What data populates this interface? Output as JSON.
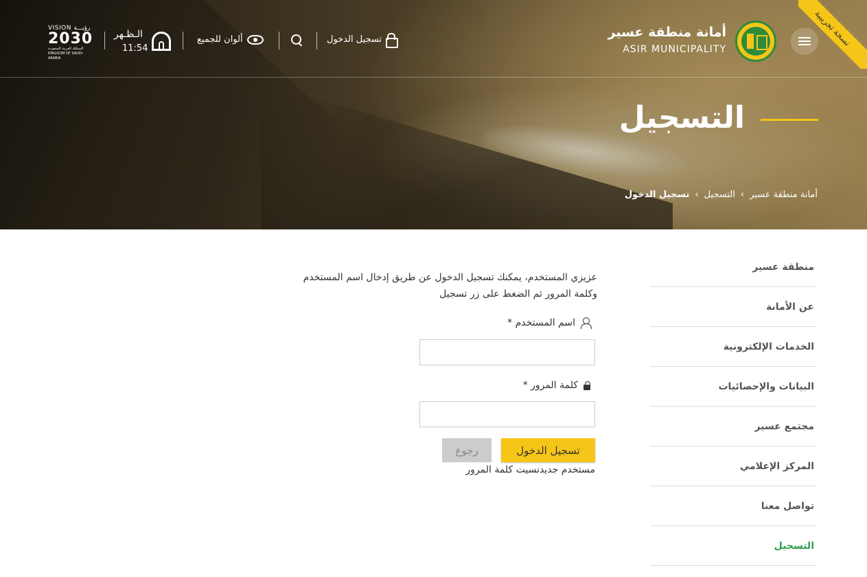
{
  "header": {
    "ribbon": "نسخة تجريبية",
    "logo_ar": "أمانة منطقة عسير",
    "logo_en": "ASIR MUNICIPALITY",
    "login_label": "تسجيل الدخول",
    "colors_label": "ألوان للجميع",
    "prayer_name": "الـظـهر",
    "prayer_time": "11:54",
    "vision_top": "VISION رؤيـــة",
    "vision_year": "2030",
    "vision_bottom": "المملكة العربية السعودية KINGDOM OF SAUDI ARABIA"
  },
  "hero": {
    "title": "التسجيل",
    "breadcrumb": [
      "أمانة منطقة عسير",
      "التسجيل",
      "تسجيل الدخول"
    ],
    "breadcrumb_sep": "›"
  },
  "sidebar": {
    "items": [
      {
        "label": "منطقة عسير"
      },
      {
        "label": "عن الأمانة"
      },
      {
        "label": "الخدمات الإلكترونية"
      },
      {
        "label": "البيانات والإحصائيات"
      },
      {
        "label": "مجتمع عسير"
      },
      {
        "label": "المركز الإعلامي"
      },
      {
        "label": "تواصل معنا"
      },
      {
        "label": "التسجيل"
      }
    ]
  },
  "form": {
    "intro": "عزيزي المستخدم، يمكنك تسجيل الدخول عن طريق إدخال اسم المستخدم وكلمة المرور ثم الضغط على زر تسجيل",
    "username_label": "اسم المستخدم *",
    "username_value": "",
    "password_label": "كلمة المرور *",
    "password_value": "",
    "login_button": "تسجيل الدخول",
    "back_button": "رجوع",
    "links": "مستخدم جديدنسيت كلمة المرور"
  },
  "colors": {
    "accent": "#f5c518",
    "active_green": "#2e9e4f"
  }
}
